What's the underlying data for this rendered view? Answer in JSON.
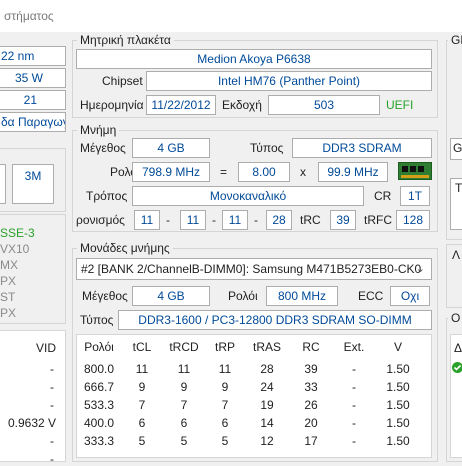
{
  "window": {
    "title": "στήματος"
  },
  "left_panel": {
    "tech": "22 nm",
    "tdp": "35 W",
    "stepping": "21",
    "vendor_btn": "δα Παραγωγ",
    "cache": "3M",
    "instructions": [
      "SSE-3",
      "VX10",
      "MX",
      "PX",
      "ST",
      "PX"
    ],
    "vid_header": "VID",
    "vid_rows": [
      "-",
      "-",
      "-",
      "0.9632 V",
      "-",
      "-"
    ]
  },
  "motherboard": {
    "legend": "Μητρική πλακέτα",
    "model": "Medion Akoya P6638",
    "chipset_label": "Chipset",
    "chipset": "Intel HM76 (Panther Point)",
    "date_label": "Ημερομηνία",
    "date": "11/22/2012",
    "version_label": "Εκδοχή",
    "version": "503",
    "uefi": "UEFI"
  },
  "memory": {
    "legend": "Μνήμη",
    "size_label": "Μέγεθος",
    "size": "4 GB",
    "type_label": "Τύπος",
    "type": "DDR3 SDRAM",
    "clock_label": "Ρολόι",
    "clock": "798.9 MHz",
    "equals": "=",
    "multiplier": "8.00",
    "times": "x",
    "bus": "99.9 MHz",
    "mode_label": "Τρόπος",
    "mode": "Μονοκαναλικό",
    "cr_label": "CR",
    "cr": "1T",
    "timing_label": "ρονισμός",
    "timings": [
      "11",
      "11",
      "11",
      "28"
    ],
    "dash": "-",
    "trc_label": "tRC",
    "trc": "39",
    "trfc_label": "tRFC",
    "trfc": "128"
  },
  "modules": {
    "legend": "Μονάδες μνήμης",
    "selected": "#2 [BANK 2/ChannelB-DIMM0]: Samsung M471B5273EB0-CK0",
    "size_label": "Μέγεθος",
    "size": "4 GB",
    "clock_label": "Ρολόι",
    "clock": "800 MHz",
    "ecc_label": "ECC",
    "ecc": "Οχι",
    "type_label": "Τύπος",
    "type": "DDR3-1600 / PC3-12800 DDR3 SDRAM SO-DIMM",
    "columns": [
      "Ρολόι",
      "tCL",
      "tRCD",
      "tRP",
      "tRAS",
      "RC",
      "Ext.",
      "V"
    ],
    "rows": [
      [
        "800.0",
        "11",
        "11",
        "11",
        "28",
        "39",
        "-",
        "1.50"
      ],
      [
        "666.7",
        "9",
        "9",
        "9",
        "24",
        "33",
        "-",
        "1.50"
      ],
      [
        "533.3",
        "7",
        "7",
        "7",
        "19",
        "26",
        "-",
        "1.50"
      ],
      [
        "400.0",
        "6",
        "6",
        "6",
        "14",
        "20",
        "-",
        "1.50"
      ],
      [
        "333.3",
        "5",
        "5",
        "5",
        "12",
        "17",
        "-",
        "1.50"
      ]
    ]
  },
  "right_panel": {
    "gpu_legend": "GP",
    "gpu_btn": "G",
    "t_label": "T",
    "l_label": "Λ",
    "o_legend": "Ο",
    "d_label": "Δ"
  }
}
